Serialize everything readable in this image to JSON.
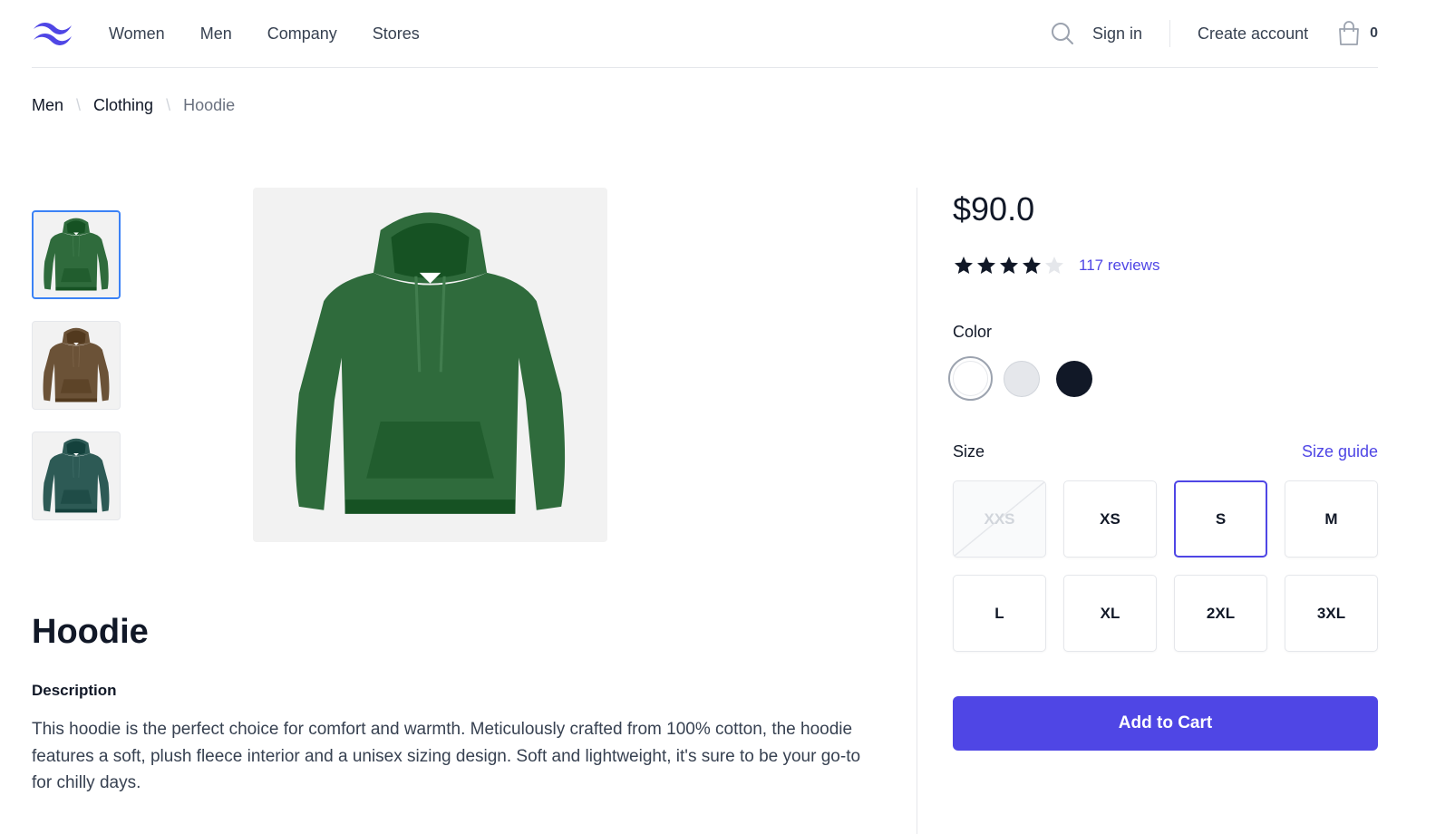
{
  "header": {
    "nav": [
      "Women",
      "Men",
      "Company",
      "Stores"
    ],
    "sign_in": "Sign in",
    "create_account": "Create account",
    "cart_count": "0",
    "brand_color": "#4f46e5"
  },
  "breadcrumb": {
    "items": [
      "Men",
      "Clothing"
    ],
    "separator": "\\",
    "current": "Hoodie"
  },
  "gallery": {
    "thumbnails": [
      {
        "color_name": "green",
        "color": "#2f6b3c"
      },
      {
        "color_name": "brown",
        "color": "#6b5237"
      },
      {
        "color_name": "teal",
        "color": "#2d5a55"
      }
    ],
    "selected_index": 0,
    "main_image_color": "#2f6b3c"
  },
  "product": {
    "title": "Hoodie",
    "description_label": "Description",
    "description": "This hoodie is the perfect choice for comfort and warmth. Meticulously crafted from 100% cotton, the hoodie features a soft, plush fleece interior and a unisex sizing design. Soft and lightweight, it's sure to be your go-to for chilly days.",
    "price": "$90.0",
    "rating": 4,
    "rating_max": 5,
    "reviews": "117 reviews"
  },
  "color": {
    "label": "Color",
    "swatches": [
      "#ffffff",
      "#e5e7eb",
      "#111827"
    ],
    "selected_index": 0
  },
  "size": {
    "label": "Size",
    "guide": "Size guide",
    "options": [
      {
        "label": "XXS",
        "available": false
      },
      {
        "label": "XS",
        "available": true
      },
      {
        "label": "S",
        "available": true,
        "selected": true
      },
      {
        "label": "M",
        "available": true
      },
      {
        "label": "L",
        "available": true
      },
      {
        "label": "XL",
        "available": true
      },
      {
        "label": "2XL",
        "available": true
      },
      {
        "label": "3XL",
        "available": true
      }
    ]
  },
  "cta": {
    "add_to_cart": "Add to Cart"
  }
}
